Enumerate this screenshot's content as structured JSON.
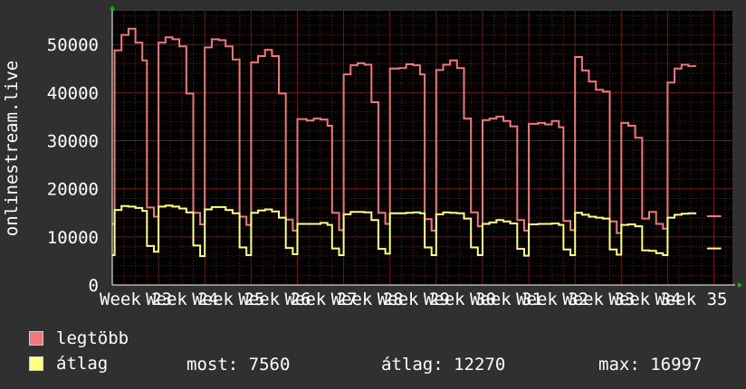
{
  "chart_data": {
    "type": "line",
    "ylabel": "onlinestream.live",
    "yticks": [
      0,
      10000,
      20000,
      30000,
      40000,
      50000
    ],
    "ylim": [
      0,
      57000
    ],
    "x_tick_labels": [
      "Week 23",
      "Week 24",
      "Week 25",
      "Week 26",
      "Week 27",
      "Week 28",
      "Week 29",
      "Week 30",
      "Week 31",
      "Week 32",
      "Week 33",
      "Week 34",
      "Week 35"
    ],
    "x_range": [
      0,
      13.4
    ],
    "grid": true,
    "colors": {
      "background": "#000000",
      "grid": "#6b1a1a",
      "axis": "#ffffff",
      "arrow": "#00c000"
    },
    "series": [
      {
        "name": "legtöbb",
        "color": "#f07878",
        "points": [
          [
            0.0,
            12700
          ],
          [
            0.05,
            48800
          ],
          [
            0.2,
            52000
          ],
          [
            0.35,
            53300
          ],
          [
            0.5,
            50400
          ],
          [
            0.65,
            46700
          ],
          [
            0.75,
            16100
          ],
          [
            0.9,
            14200
          ],
          [
            1.0,
            50400
          ],
          [
            1.15,
            51500
          ],
          [
            1.3,
            51100
          ],
          [
            1.45,
            49600
          ],
          [
            1.6,
            39800
          ],
          [
            1.75,
            15000
          ],
          [
            1.9,
            12600
          ],
          [
            2.0,
            49400
          ],
          [
            2.15,
            51100
          ],
          [
            2.3,
            50900
          ],
          [
            2.45,
            49600
          ],
          [
            2.6,
            46900
          ],
          [
            2.75,
            14200
          ],
          [
            2.9,
            12500
          ],
          [
            3.0,
            46300
          ],
          [
            3.15,
            47600
          ],
          [
            3.3,
            48900
          ],
          [
            3.45,
            47600
          ],
          [
            3.6,
            39800
          ],
          [
            3.75,
            13600
          ],
          [
            3.9,
            11300
          ],
          [
            4.0,
            34500
          ],
          [
            4.2,
            34200
          ],
          [
            4.35,
            34600
          ],
          [
            4.5,
            34400
          ],
          [
            4.65,
            33100
          ],
          [
            4.75,
            15000
          ],
          [
            4.9,
            11400
          ],
          [
            5.0,
            43800
          ],
          [
            5.15,
            45700
          ],
          [
            5.3,
            46100
          ],
          [
            5.45,
            45800
          ],
          [
            5.6,
            38000
          ],
          [
            5.75,
            15000
          ],
          [
            5.9,
            12700
          ],
          [
            6.0,
            45000
          ],
          [
            6.2,
            45100
          ],
          [
            6.35,
            45900
          ],
          [
            6.5,
            45700
          ],
          [
            6.65,
            43800
          ],
          [
            6.75,
            13700
          ],
          [
            6.9,
            11300
          ],
          [
            7.0,
            44700
          ],
          [
            7.15,
            45800
          ],
          [
            7.3,
            46700
          ],
          [
            7.45,
            45100
          ],
          [
            7.6,
            34600
          ],
          [
            7.75,
            15100
          ],
          [
            7.9,
            12200
          ],
          [
            8.0,
            34300
          ],
          [
            8.15,
            34600
          ],
          [
            8.3,
            35000
          ],
          [
            8.45,
            34100
          ],
          [
            8.6,
            33000
          ],
          [
            8.75,
            13500
          ],
          [
            8.9,
            11300
          ],
          [
            9.0,
            33500
          ],
          [
            9.2,
            33700
          ],
          [
            9.35,
            33400
          ],
          [
            9.5,
            34100
          ],
          [
            9.65,
            32800
          ],
          [
            9.75,
            13300
          ],
          [
            9.9,
            11400
          ],
          [
            10.0,
            47400
          ],
          [
            10.15,
            44600
          ],
          [
            10.3,
            42300
          ],
          [
            10.45,
            40600
          ],
          [
            10.6,
            40200
          ],
          [
            10.75,
            13200
          ],
          [
            10.9,
            10800
          ],
          [
            11.0,
            33700
          ],
          [
            11.15,
            33100
          ],
          [
            11.3,
            30600
          ],
          [
            11.45,
            13800
          ],
          [
            11.6,
            15200
          ],
          [
            11.75,
            12700
          ],
          [
            11.9,
            11700
          ],
          [
            12.0,
            42100
          ],
          [
            12.15,
            45000
          ],
          [
            12.3,
            45800
          ],
          [
            12.45,
            45500
          ],
          [
            12.6,
            45400
          ],
          [
            12.67,
            null
          ],
          [
            12.85,
            14300
          ],
          [
            13.0,
            14300
          ]
        ]
      },
      {
        "name": "átlag",
        "color": "#ffff80",
        "points": [
          [
            0.0,
            6200
          ],
          [
            0.05,
            15600
          ],
          [
            0.2,
            16400
          ],
          [
            0.35,
            16300
          ],
          [
            0.5,
            16000
          ],
          [
            0.65,
            15400
          ],
          [
            0.75,
            8100
          ],
          [
            0.9,
            6900
          ],
          [
            1.0,
            16300
          ],
          [
            1.15,
            16500
          ],
          [
            1.3,
            16300
          ],
          [
            1.45,
            15900
          ],
          [
            1.6,
            15100
          ],
          [
            1.75,
            8200
          ],
          [
            1.9,
            6000
          ],
          [
            2.0,
            15700
          ],
          [
            2.15,
            16200
          ],
          [
            2.3,
            16200
          ],
          [
            2.45,
            15600
          ],
          [
            2.6,
            14900
          ],
          [
            2.75,
            7800
          ],
          [
            2.9,
            6200
          ],
          [
            3.0,
            15000
          ],
          [
            3.15,
            15500
          ],
          [
            3.3,
            15700
          ],
          [
            3.45,
            15300
          ],
          [
            3.6,
            14000
          ],
          [
            3.75,
            7700
          ],
          [
            3.9,
            6400
          ],
          [
            4.0,
            12700
          ],
          [
            4.2,
            12700
          ],
          [
            4.35,
            12700
          ],
          [
            4.5,
            12900
          ],
          [
            4.65,
            12500
          ],
          [
            4.75,
            7600
          ],
          [
            4.9,
            6200
          ],
          [
            5.0,
            14700
          ],
          [
            5.15,
            15200
          ],
          [
            5.3,
            15200
          ],
          [
            5.45,
            15100
          ],
          [
            5.6,
            13500
          ],
          [
            5.75,
            7500
          ],
          [
            5.9,
            6500
          ],
          [
            6.0,
            14900
          ],
          [
            6.2,
            14900
          ],
          [
            6.35,
            15000
          ],
          [
            6.5,
            15100
          ],
          [
            6.65,
            14900
          ],
          [
            6.75,
            7800
          ],
          [
            6.9,
            6200
          ],
          [
            7.0,
            14700
          ],
          [
            7.15,
            15100
          ],
          [
            7.3,
            15000
          ],
          [
            7.45,
            14900
          ],
          [
            7.6,
            13800
          ],
          [
            7.75,
            7800
          ],
          [
            7.9,
            6200
          ],
          [
            8.0,
            12700
          ],
          [
            8.15,
            13000
          ],
          [
            8.3,
            13500
          ],
          [
            8.45,
            13200
          ],
          [
            8.6,
            12800
          ],
          [
            8.75,
            7500
          ],
          [
            8.9,
            6100
          ],
          [
            9.0,
            12600
          ],
          [
            9.2,
            12700
          ],
          [
            9.35,
            12700
          ],
          [
            9.5,
            12800
          ],
          [
            9.65,
            12500
          ],
          [
            9.75,
            7400
          ],
          [
            9.9,
            6200
          ],
          [
            10.0,
            15000
          ],
          [
            10.15,
            14600
          ],
          [
            10.3,
            14200
          ],
          [
            10.45,
            14000
          ],
          [
            10.6,
            13800
          ],
          [
            10.75,
            7400
          ],
          [
            10.9,
            6300
          ],
          [
            11.0,
            12500
          ],
          [
            11.15,
            12600
          ],
          [
            11.3,
            12200
          ],
          [
            11.45,
            7200
          ],
          [
            11.6,
            7100
          ],
          [
            11.75,
            6600
          ],
          [
            11.9,
            6200
          ],
          [
            12.0,
            14000
          ],
          [
            12.15,
            14600
          ],
          [
            12.3,
            14800
          ],
          [
            12.45,
            14900
          ],
          [
            12.6,
            14700
          ],
          [
            12.67,
            null
          ],
          [
            12.85,
            7600
          ],
          [
            13.0,
            7600
          ]
        ]
      }
    ]
  },
  "legend": [
    {
      "label": "legtöbb",
      "color": "#f07878"
    },
    {
      "label": "átlag",
      "color": "#ffff80"
    }
  ],
  "stats": {
    "most": "most: 7560",
    "atlag": "átlag: 12270",
    "max": "max: 16997"
  }
}
